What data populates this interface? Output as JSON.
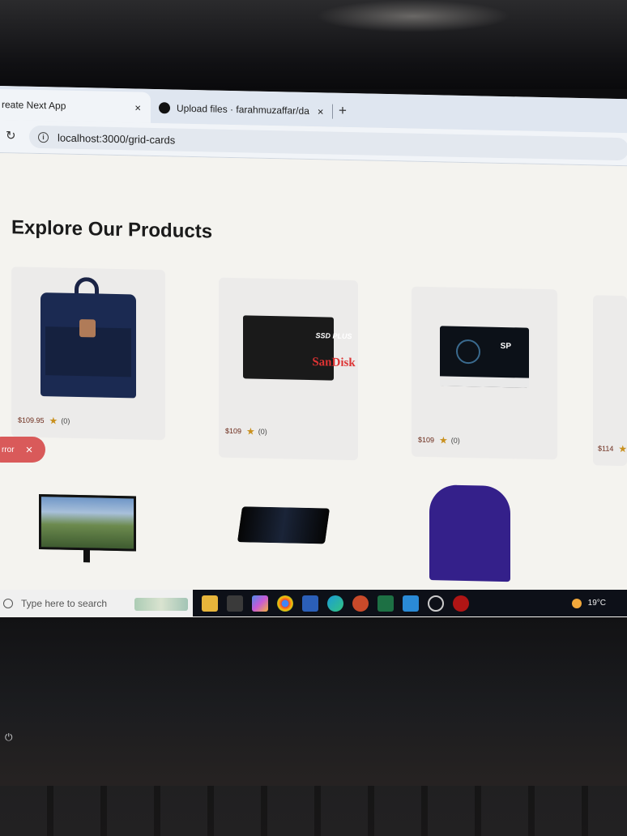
{
  "browser": {
    "tabs": [
      {
        "title": "reate Next App",
        "close": "×"
      },
      {
        "title": "Upload files · farahmuzaffar/da",
        "close": "×"
      }
    ],
    "new_tab": "+",
    "reload_icon": "reload-icon",
    "address": "localhost:3000/grid-cards"
  },
  "page": {
    "heading": "Explore Our Products",
    "products": [
      {
        "price": "$109.95",
        "rating": "(0)",
        "image": "backpack"
      },
      {
        "price": "$109",
        "rating": "(0)",
        "image": "sandisk-ssd"
      },
      {
        "price": "$109",
        "rating": "(0)",
        "image": "silicon-power-ssd"
      },
      {
        "price": "$114",
        "rating": "",
        "image": "partial-card"
      },
      {
        "price": "",
        "rating": "",
        "image": "monitor"
      },
      {
        "price": "",
        "rating": "",
        "image": "curved-gaming-monitor"
      },
      {
        "price": "",
        "rating": "",
        "image": "purple-jacket"
      }
    ],
    "ssd_labels": {
      "model": "SSD PLUS",
      "brand": "SanDisk",
      "sp_brand": "SP"
    }
  },
  "toast": {
    "text": "rror",
    "close": "×",
    "color": "#d95a5a"
  },
  "taskbar": {
    "search_placeholder": "Type here to search",
    "temperature": "19°C",
    "apps": [
      "file-explorer-icon",
      "store-icon",
      "copilot-icon",
      "chrome-icon",
      "word-icon",
      "edge-icon",
      "powerpoint-icon",
      "excel-icon",
      "vscode-icon",
      "whatsapp-icon",
      "recording-icon"
    ]
  },
  "colors": {
    "accent_star": "#c9901d",
    "price": "#6b2a1a",
    "page_bg": "#f4f3ef"
  }
}
